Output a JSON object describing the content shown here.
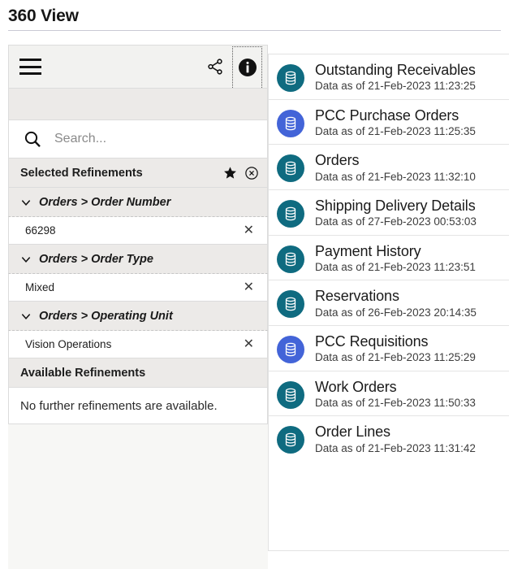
{
  "page": {
    "title": "360 View"
  },
  "left_panel": {
    "toolbar": {
      "menu_icon": "hamburger-menu-icon",
      "share_icon": "share-icon",
      "info_icon": "info-icon"
    },
    "search": {
      "icon": "search-icon",
      "placeholder": "Search...",
      "value": ""
    },
    "selected_refinements": {
      "title": "Selected Refinements",
      "star_icon": "star-icon",
      "clear_icon": "clear-all-icon",
      "groups": [
        {
          "label": "Orders > Order Number",
          "chevron": "chevron-down-icon",
          "values": [
            {
              "label": "66298",
              "remove_icon": "remove-icon"
            }
          ]
        },
        {
          "label": "Orders > Order Type",
          "chevron": "chevron-down-icon",
          "values": [
            {
              "label": "Mixed",
              "remove_icon": "remove-icon"
            }
          ]
        },
        {
          "label": "Orders > Operating Unit",
          "chevron": "chevron-down-icon",
          "values": [
            {
              "label": "Vision Operations",
              "remove_icon": "remove-icon"
            }
          ]
        }
      ]
    },
    "available_refinements": {
      "title": "Available Refinements",
      "empty_message": "No further refinements are available."
    }
  },
  "right_panel": {
    "colors": {
      "teal": "#0f6b80",
      "blue": "#4364d8"
    },
    "items": [
      {
        "name": "Outstanding Receivables",
        "subtitle": "Data as of 21-Feb-2023 11:23:25",
        "color": "#0f6b80",
        "icon": "database-icon"
      },
      {
        "name": "PCC Purchase Orders",
        "subtitle": "Data as of 21-Feb-2023 11:25:35",
        "color": "#4364d8",
        "icon": "database-icon"
      },
      {
        "name": "Orders",
        "subtitle": "Data as of 21-Feb-2023 11:32:10",
        "color": "#0f6b80",
        "icon": "database-icon"
      },
      {
        "name": "Shipping Delivery Details",
        "subtitle": "Data as of 27-Feb-2023 00:53:03",
        "color": "#0f6b80",
        "icon": "database-icon"
      },
      {
        "name": "Payment History",
        "subtitle": "Data as of 21-Feb-2023 11:23:51",
        "color": "#0f6b80",
        "icon": "database-icon"
      },
      {
        "name": "Reservations",
        "subtitle": "Data as of 26-Feb-2023 20:14:35",
        "color": "#0f6b80",
        "icon": "database-icon"
      },
      {
        "name": "PCC Requisitions",
        "subtitle": "Data as of 21-Feb-2023 11:25:29",
        "color": "#4364d8",
        "icon": "database-icon"
      },
      {
        "name": "Work Orders",
        "subtitle": "Data as of 21-Feb-2023 11:50:33",
        "color": "#0f6b80",
        "icon": "database-icon"
      },
      {
        "name": "Order Lines",
        "subtitle": "Data as of 21-Feb-2023 11:31:42",
        "color": "#0f6b80",
        "icon": "database-icon"
      }
    ]
  }
}
